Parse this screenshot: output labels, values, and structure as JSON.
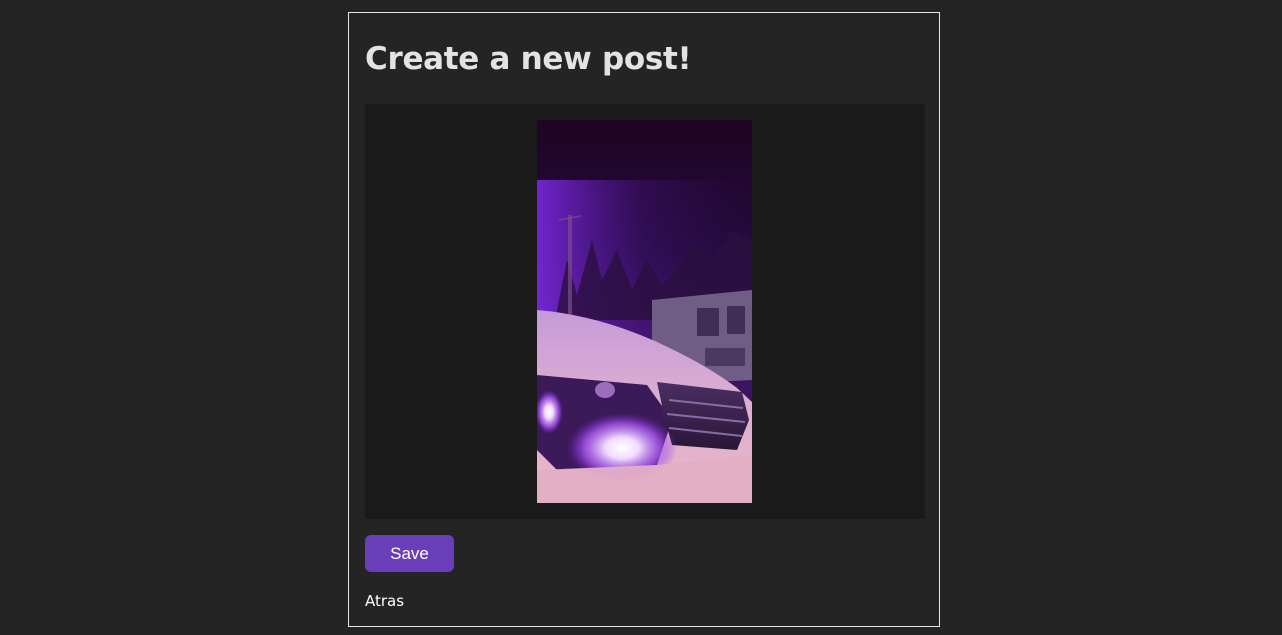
{
  "page": {
    "title": "Create a new post!"
  },
  "preview": {
    "image_icon": "photo-preview-night-car-headlight"
  },
  "actions": {
    "save_label": "Save",
    "back_label": "Atras"
  },
  "colors": {
    "background": "#242424",
    "card_border": "#e6e6e6",
    "preview_background": "#1a1a1a",
    "save_button": "#6a3eb8"
  }
}
